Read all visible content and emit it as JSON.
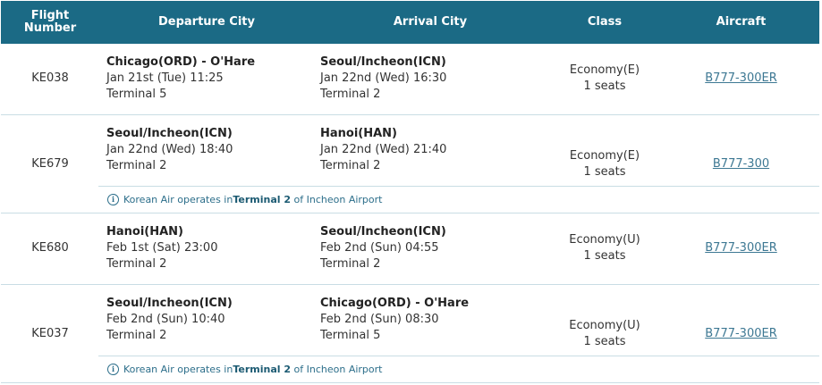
{
  "header": {
    "flight_number": "Flight Number",
    "departure_city": "Departure City",
    "arrival_city": "Arrival City",
    "class": "Class",
    "aircraft": "Aircraft"
  },
  "info_icon": "info-icon",
  "flights": [
    {
      "number": "KE038",
      "dep_city": "Chicago(ORD) - O'Hare",
      "dep_time": "Jan 21st (Tue) 11:25",
      "dep_terminal": "Terminal 5",
      "arr_city": "Seoul/Incheon(ICN)",
      "arr_time": "Jan 22nd (Wed) 16:30",
      "arr_terminal": "Terminal 2",
      "class": "Economy(E)",
      "seats": "1 seats",
      "aircraft": "B777-300ER"
    },
    {
      "number": "KE679",
      "dep_city": "Seoul/Incheon(ICN)",
      "dep_time": "Jan 22nd (Wed) 18:40",
      "dep_terminal": "Terminal 2",
      "arr_city": "Hanoi(HAN)",
      "arr_time": "Jan 22nd (Wed) 21:40",
      "arr_terminal": "Terminal 2",
      "class": "Economy(E)",
      "seats": "1 seats",
      "aircraft": "B777-300",
      "note": {
        "pre": "Korean Air operates in ",
        "bold": "Terminal 2",
        "post": " of Incheon Airport"
      }
    },
    {
      "number": "KE680",
      "dep_city": "Hanoi(HAN)",
      "dep_time": "Feb 1st (Sat) 23:00",
      "dep_terminal": "Terminal 2",
      "arr_city": "Seoul/Incheon(ICN)",
      "arr_time": "Feb 2nd (Sun) 04:55",
      "arr_terminal": "Terminal 2",
      "class": "Economy(U)",
      "seats": "1 seats",
      "aircraft": "B777-300ER"
    },
    {
      "number": "KE037",
      "dep_city": "Seoul/Incheon(ICN)",
      "dep_time": "Feb 2nd (Sun) 10:40",
      "dep_terminal": "Terminal 2",
      "arr_city": "Chicago(ORD) - O'Hare",
      "arr_time": "Feb 2nd (Sun) 08:30",
      "arr_terminal": "Terminal 5",
      "class": "Economy(U)",
      "seats": "1 seats",
      "aircraft": "B777-300ER",
      "note": {
        "pre": "Korean Air operates in ",
        "bold": "Terminal 2",
        "post": " of Incheon Airport"
      }
    }
  ]
}
